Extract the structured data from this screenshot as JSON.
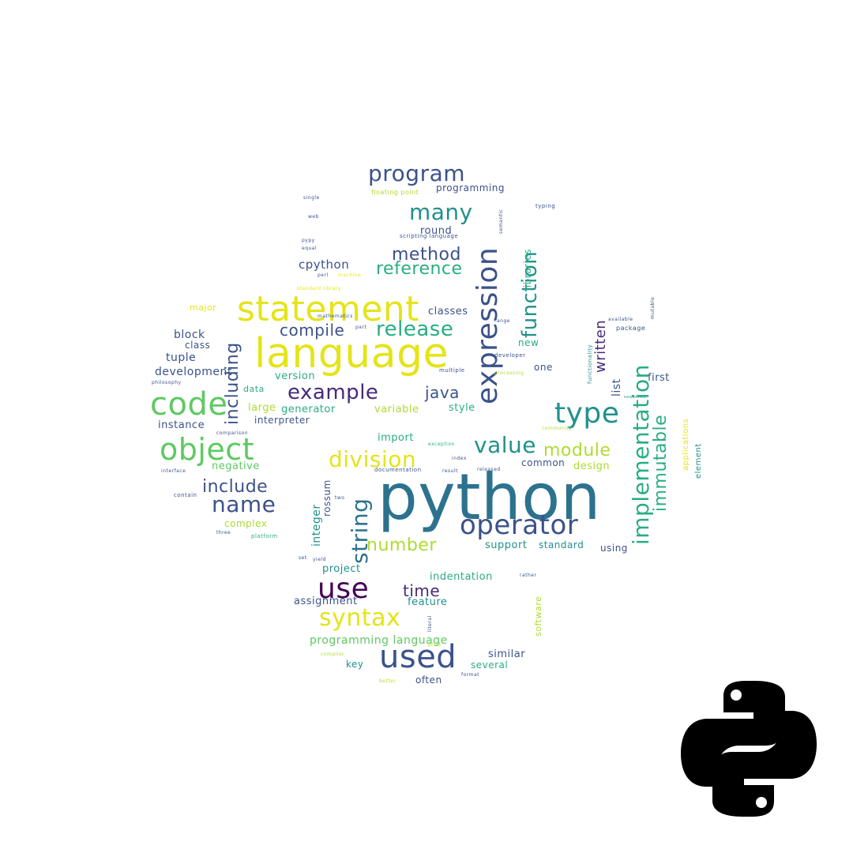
{
  "colors": {
    "purple": "#472a7a",
    "indigo": "#3b528b",
    "teal": "#2c728e",
    "cyan": "#21918c",
    "green": "#28ae80",
    "lime": "#5ec962",
    "yellowgreen": "#addc30",
    "yellow": "#e4e419",
    "deep": "#440154",
    "logo": "#000000"
  },
  "logo": {
    "icon": "python-logo-icon"
  },
  "words": [
    {
      "t": "python",
      "c": "teal"
    },
    {
      "t": "language",
      "c": "yellow"
    },
    {
      "t": "statement",
      "c": "yellow"
    },
    {
      "t": "expression",
      "c": "indigo"
    },
    {
      "t": "code",
      "c": "lime"
    },
    {
      "t": "object",
      "c": "lime"
    },
    {
      "t": "type",
      "c": "cyan"
    },
    {
      "t": "implementation",
      "c": "green"
    },
    {
      "t": "operator",
      "c": "indigo"
    },
    {
      "t": "use",
      "c": "deep"
    },
    {
      "t": "used",
      "c": "indigo"
    },
    {
      "t": "program",
      "c": "indigo"
    },
    {
      "t": "many",
      "c": "cyan"
    },
    {
      "t": "syntax",
      "c": "yellow"
    },
    {
      "t": "function",
      "c": "cyan"
    },
    {
      "t": "string",
      "c": "teal"
    },
    {
      "t": "division",
      "c": "yellow"
    },
    {
      "t": "value",
      "c": "cyan"
    },
    {
      "t": "name",
      "c": "indigo"
    },
    {
      "t": "example",
      "c": "purple"
    },
    {
      "t": "release",
      "c": "green"
    },
    {
      "t": "number",
      "c": "yellowgreen"
    },
    {
      "t": "module",
      "c": "yellowgreen"
    },
    {
      "t": "immutable",
      "c": "green"
    },
    {
      "t": "including",
      "c": "indigo"
    },
    {
      "t": "include",
      "c": "indigo"
    },
    {
      "t": "method",
      "c": "indigo"
    },
    {
      "t": "reference",
      "c": "green"
    },
    {
      "t": "compile",
      "c": "indigo"
    },
    {
      "t": "java",
      "c": "indigo"
    },
    {
      "t": "time",
      "c": "purple"
    },
    {
      "t": "written",
      "c": "purple"
    },
    {
      "t": "cpython",
      "c": "indigo"
    },
    {
      "t": "block",
      "c": "indigo"
    },
    {
      "t": "class",
      "c": "indigo"
    },
    {
      "t": "tuple",
      "c": "indigo"
    },
    {
      "t": "development",
      "c": "indigo"
    },
    {
      "t": "instance",
      "c": "indigo"
    },
    {
      "t": "negative",
      "c": "lime"
    },
    {
      "t": "major",
      "c": "yellow"
    },
    {
      "t": "version",
      "c": "green"
    },
    {
      "t": "data",
      "c": "green"
    },
    {
      "t": "large",
      "c": "yellowgreen"
    },
    {
      "t": "generator",
      "c": "green"
    },
    {
      "t": "interpreter",
      "c": "indigo"
    },
    {
      "t": "variable",
      "c": "yellowgreen"
    },
    {
      "t": "style",
      "c": "green"
    },
    {
      "t": "import",
      "c": "green"
    },
    {
      "t": "classes",
      "c": "indigo"
    },
    {
      "t": "new",
      "c": "green"
    },
    {
      "t": "one",
      "c": "indigo"
    },
    {
      "t": "list",
      "c": "indigo"
    },
    {
      "t": "first",
      "c": "indigo"
    },
    {
      "t": "common",
      "c": "indigo"
    },
    {
      "t": "design",
      "c": "yellowgreen"
    },
    {
      "t": "support",
      "c": "cyan"
    },
    {
      "t": "standard",
      "c": "cyan"
    },
    {
      "t": "using",
      "c": "indigo"
    },
    {
      "t": "complex",
      "c": "yellowgreen"
    },
    {
      "t": "integer",
      "c": "cyan"
    },
    {
      "t": "rossum",
      "c": "indigo"
    },
    {
      "t": "project",
      "c": "cyan"
    },
    {
      "t": "indentation",
      "c": "green"
    },
    {
      "t": "assignment",
      "c": "indigo"
    },
    {
      "t": "feature",
      "c": "cyan"
    },
    {
      "t": "programming language",
      "c": "lime"
    },
    {
      "t": "similar",
      "c": "indigo"
    },
    {
      "t": "key",
      "c": "cyan"
    },
    {
      "t": "several",
      "c": "green"
    },
    {
      "t": "often",
      "c": "indigo"
    },
    {
      "t": "software",
      "c": "yellowgreen"
    },
    {
      "t": "round",
      "c": "indigo"
    },
    {
      "t": "programming",
      "c": "indigo"
    },
    {
      "t": "libraries",
      "c": "green"
    },
    {
      "t": "applications",
      "c": "yellow"
    },
    {
      "t": "element",
      "c": "cyan"
    },
    {
      "t": "package",
      "c": "indigo"
    },
    {
      "t": "functionality",
      "c": "cyan"
    },
    {
      "t": "floating point",
      "c": "yellowgreen"
    },
    {
      "t": "scripting language",
      "c": "indigo"
    },
    {
      "t": "typing",
      "c": "indigo"
    },
    {
      "t": "semantic",
      "c": "indigo"
    },
    {
      "t": "standard library",
      "c": "yellow"
    },
    {
      "t": "mathematics",
      "c": "indigo"
    },
    {
      "t": "multiple",
      "c": "indigo"
    },
    {
      "t": "developer",
      "c": "indigo"
    },
    {
      "t": "processing",
      "c": "yellowgreen"
    },
    {
      "t": "community",
      "c": "yellowgreen"
    },
    {
      "t": "exception",
      "c": "green"
    },
    {
      "t": "index",
      "c": "indigo"
    },
    {
      "t": "documentation",
      "c": "indigo"
    },
    {
      "t": "result",
      "c": "indigo"
    },
    {
      "t": "released",
      "c": "indigo"
    },
    {
      "t": "comparison",
      "c": "indigo"
    },
    {
      "t": "interface",
      "c": "indigo"
    },
    {
      "t": "contain",
      "c": "indigo"
    },
    {
      "t": "three",
      "c": "indigo"
    },
    {
      "t": "platform",
      "c": "green"
    },
    {
      "t": "philosophy",
      "c": "indigo"
    },
    {
      "t": "single",
      "c": "indigo"
    },
    {
      "t": "equal",
      "c": "indigo"
    },
    {
      "t": "perl",
      "c": "indigo"
    },
    {
      "t": "machine",
      "c": "yellow"
    },
    {
      "t": "mutable",
      "c": "indigo"
    },
    {
      "t": "available",
      "c": "indigo"
    },
    {
      "t": "sequence",
      "c": "cyan"
    },
    {
      "t": "rather",
      "c": "indigo"
    },
    {
      "t": "compiler",
      "c": "yellowgreen"
    },
    {
      "t": "format",
      "c": "indigo"
    },
    {
      "t": "better",
      "c": "yellowgreen"
    },
    {
      "t": "literal",
      "c": "indigo"
    },
    {
      "t": "print",
      "c": "yellowgreen"
    },
    {
      "t": "pypy",
      "c": "indigo"
    },
    {
      "t": "web",
      "c": "indigo"
    },
    {
      "t": "part",
      "c": "indigo"
    },
    {
      "t": "range",
      "c": "indigo"
    },
    {
      "t": "two",
      "c": "indigo"
    },
    {
      "t": "set",
      "c": "indigo"
    },
    {
      "t": "yield",
      "c": "indigo"
    }
  ]
}
